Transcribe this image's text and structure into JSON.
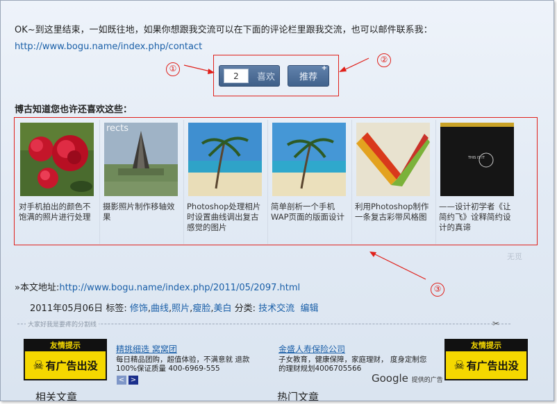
{
  "intro": {
    "text": "OK~到这里结束，一如既往地，如果你想跟我交流可以在下面的评论栏里跟我交流，也可以邮件联系我：",
    "link": "http://www.bogu.name/index.php/contact"
  },
  "annotations": {
    "one": "①",
    "two": "②",
    "three": "③"
  },
  "like": {
    "count": "2",
    "label": "喜欢"
  },
  "recommend": {
    "label": "推荐",
    "plus": "+"
  },
  "related": {
    "heading": "博古知道您也许还喜欢这些：",
    "items": [
      {
        "title": "对手机拍出的颜色不饱满的照片进行处理"
      },
      {
        "title": "摄影照片制作移轴效果"
      },
      {
        "title": "Photoshop处理相片时设置曲线调出复古感觉的图片"
      },
      {
        "title": "简单剖析一个手机WAP页面的版面设计"
      },
      {
        "title": "利用Photoshop制作一条复古彩带风格图"
      },
      {
        "title": "——设计初学者《让简约飞》诠释简约设计的真谛"
      }
    ],
    "thumb2_text": "rects",
    "thumb6_text": "THIS IS IT",
    "footer": "无觅"
  },
  "address": {
    "label": "»本文地址:",
    "link": "http://www.bogu.name/index.php/2011/05/2097.html"
  },
  "meta": {
    "date": "2011年05月06日",
    "tags_label": "标签:",
    "tags": [
      "修饰",
      "曲线",
      "照片",
      "瘦脸",
      "美白"
    ],
    "category_label": "分类:",
    "category": "技术交流",
    "edit": "编辑"
  },
  "divider": {
    "label": "大家好我是要疼的分割线"
  },
  "ads": {
    "badge_top": "友情提示",
    "badge_bottom": "有广告出没",
    "ad1": {
      "title": "精挑细选 窝窝团",
      "line1": "每日精品团购，超值体验，不满意就 退款",
      "line2": "100%保证质量 400-6969-555"
    },
    "ad2": {
      "title": "金盛人寿保险公司",
      "line1": "子女教育，健康保障，家庭理财， 度身定制您",
      "line2": "的理财规划4006705566"
    },
    "google": "Google",
    "google_suffix": "提供的广告"
  },
  "bottom": {
    "left": "相关文章",
    "right": "热门文章"
  },
  "colors": {
    "accent_red": "#e0201a",
    "link": "#1a5fa8"
  }
}
